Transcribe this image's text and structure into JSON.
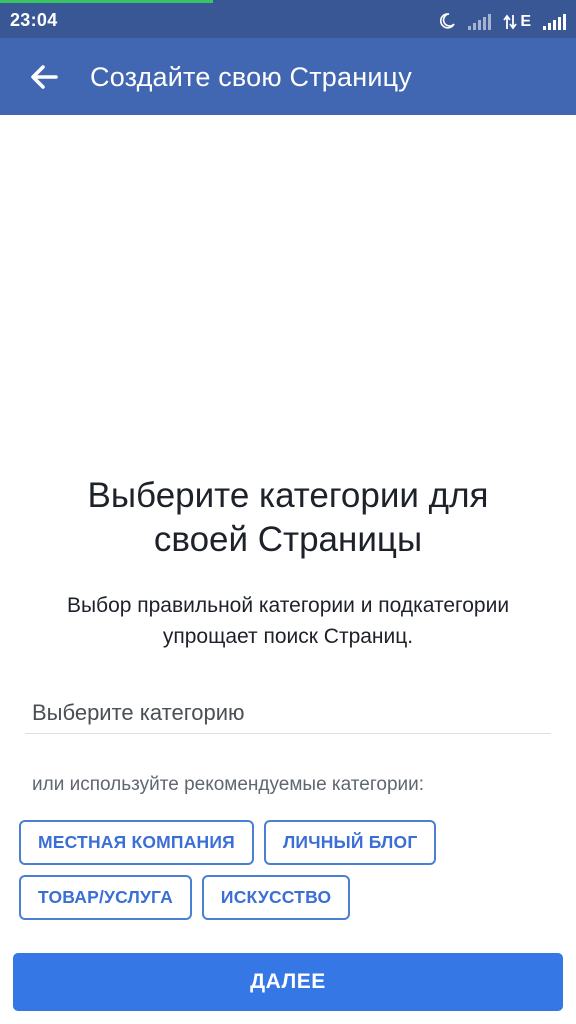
{
  "status_bar": {
    "time": "23:04",
    "network_type": "E",
    "load_progress_fraction": 0.37,
    "icons": [
      "moon-icon",
      "signal-icon",
      "data-arrows-icon",
      "signal-icon"
    ]
  },
  "app_bar": {
    "back_icon": "arrow-left-icon",
    "title": "Создайте свою Страницу"
  },
  "main": {
    "heading": "Выберите категории для своей Страницы",
    "subheading": "Выбор правильной категории и подкатегории упрощает поиск Страниц.",
    "category_field": {
      "placeholder": "Выберите категорию"
    },
    "suggested_label": "или используйте рекомендуемые категории:",
    "suggested_categories": [
      "МЕСТНАЯ КОМПАНИЯ",
      "ЛИЧНЫЙ БЛОГ",
      "ТОВАР/УСЛУГА",
      "ИСКУССТВО"
    ]
  },
  "footer": {
    "next_label": "ДАЛЕЕ"
  },
  "colors": {
    "status_bar": "#3a5795",
    "app_bar": "#4267b2",
    "accent": "#3578e5",
    "progress": "#39c463"
  }
}
